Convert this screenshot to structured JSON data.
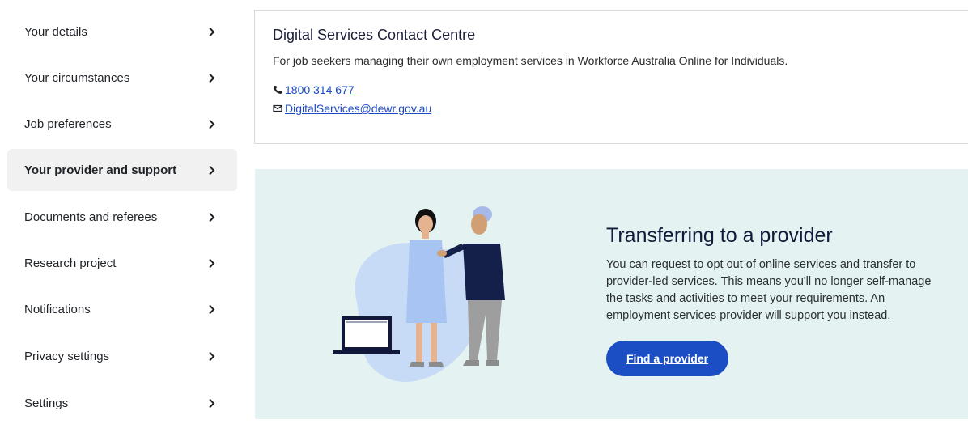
{
  "sidebar": {
    "items": [
      {
        "label": "Your details",
        "active": false
      },
      {
        "label": "Your circumstances",
        "active": false
      },
      {
        "label": "Job preferences",
        "active": false
      },
      {
        "label": "Your provider and support",
        "active": true
      },
      {
        "label": "Documents and referees",
        "active": false
      },
      {
        "label": "Research project",
        "active": false
      },
      {
        "label": "Notifications",
        "active": false
      },
      {
        "label": "Privacy settings",
        "active": false
      },
      {
        "label": "Settings",
        "active": false
      }
    ]
  },
  "contact": {
    "title": "Digital Services Contact Centre",
    "description": "For job seekers managing their own employment services in Workforce Australia Online for Individuals.",
    "phone": "1800 314 677",
    "email": "DigitalServices@dewr.gov.au"
  },
  "transfer": {
    "title": "Transferring to a provider",
    "body": "You can request to opt out of online services and transfer to provider-led services. This means you'll no longer self-manage the tasks and activities to meet your requirements. An employment services provider will support you instead.",
    "button_label": "Find a provider"
  },
  "colors": {
    "accent": "#1b4dc3",
    "link": "#1a4ac6",
    "panel_bg": "#e4f3f1",
    "active_bg": "#f1f1f2"
  },
  "icons": {
    "nav": "chevron-right-icon",
    "phone": "phone-icon",
    "email": "mail-icon"
  }
}
